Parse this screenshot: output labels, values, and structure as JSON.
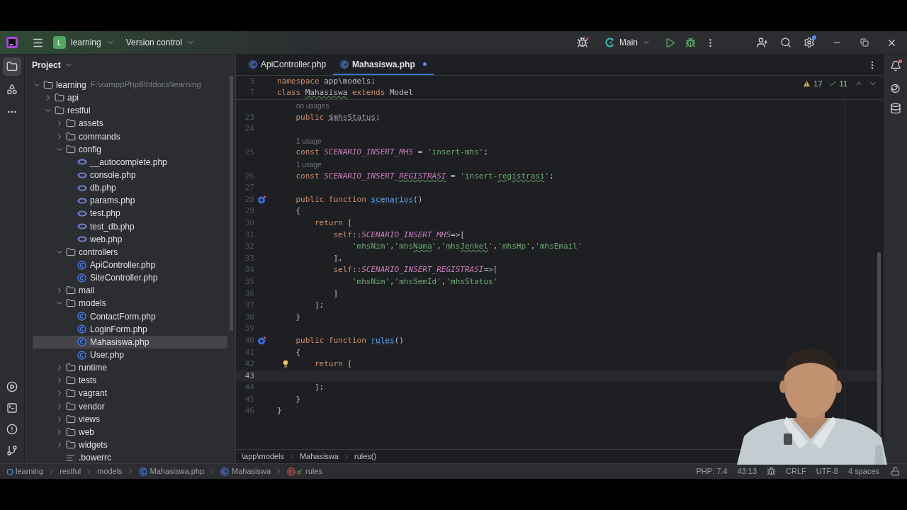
{
  "title_bar": {
    "project_badge": "L",
    "project": "learning",
    "vcs": "Version control",
    "run_config": "Main"
  },
  "left_toolbar": [
    {
      "kind": "project",
      "selected": true
    },
    {
      "kind": "structure",
      "selected": false
    },
    {
      "kind": "more",
      "selected": false
    }
  ],
  "project": {
    "title": "Project",
    "tree": [
      {
        "name": "learning",
        "kind": "folder",
        "expanded": true,
        "selected": false,
        "path": "F:\\xamppPhp8\\htdocs\\learning",
        "children": [
          {
            "name": "api",
            "kind": "folder",
            "expanded": false,
            "selected": false
          },
          {
            "name": "restful",
            "kind": "folder",
            "expanded": true,
            "selected": false,
            "children": [
              {
                "name": "assets",
                "kind": "folder",
                "expanded": false,
                "selected": false
              },
              {
                "name": "commands",
                "kind": "folder",
                "expanded": false,
                "selected": false
              },
              {
                "name": "config",
                "kind": "folder",
                "expanded": true,
                "selected": false,
                "children": [
                  {
                    "name": "__autocomplete.php",
                    "kind": "php",
                    "selected": false
                  },
                  {
                    "name": "console.php",
                    "kind": "php",
                    "selected": false
                  },
                  {
                    "name": "db.php",
                    "kind": "php",
                    "selected": false
                  },
                  {
                    "name": "params.php",
                    "kind": "php",
                    "selected": false
                  },
                  {
                    "name": "test.php",
                    "kind": "php",
                    "selected": false
                  },
                  {
                    "name": "test_db.php",
                    "kind": "php",
                    "selected": false
                  },
                  {
                    "name": "web.php",
                    "kind": "php",
                    "selected": false
                  }
                ]
              },
              {
                "name": "controllers",
                "kind": "folder",
                "expanded": true,
                "selected": false,
                "children": [
                  {
                    "name": "ApiController.php",
                    "kind": "class",
                    "selected": false
                  },
                  {
                    "name": "SiteController.php",
                    "kind": "class",
                    "selected": false
                  }
                ]
              },
              {
                "name": "mail",
                "kind": "folder",
                "expanded": false,
                "selected": false
              },
              {
                "name": "models",
                "kind": "folder",
                "expanded": true,
                "selected": false,
                "children": [
                  {
                    "name": "ContactForm.php",
                    "kind": "class",
                    "selected": false
                  },
                  {
                    "name": "LoginForm.php",
                    "kind": "class",
                    "selected": false
                  },
                  {
                    "name": "Mahasiswa.php",
                    "kind": "class",
                    "selected": true
                  },
                  {
                    "name": "User.php",
                    "kind": "class",
                    "selected": false
                  }
                ]
              },
              {
                "name": "runtime",
                "kind": "folder",
                "expanded": false,
                "selected": false
              },
              {
                "name": "tests",
                "kind": "folder",
                "expanded": false,
                "selected": false
              },
              {
                "name": "vagrant",
                "kind": "folder",
                "expanded": false,
                "selected": false
              },
              {
                "name": "vendor",
                "kind": "folder",
                "expanded": false,
                "selected": false
              },
              {
                "name": "views",
                "kind": "folder",
                "expanded": false,
                "selected": false
              },
              {
                "name": "web",
                "kind": "folder",
                "expanded": false,
                "selected": false
              },
              {
                "name": "widgets",
                "kind": "folder",
                "expanded": false,
                "selected": false
              },
              {
                "name": ".bowerrc",
                "kind": "text",
                "selected": false
              }
            ]
          }
        ]
      }
    ]
  },
  "tabs": [
    {
      "label": "ApiController.php",
      "selected": false,
      "modified": false
    },
    {
      "label": "Mahasiswa.php",
      "selected": true,
      "modified": true
    }
  ],
  "inspections": {
    "warnings": "17",
    "weak_warnings": "11"
  },
  "sticky_lines": [
    {
      "number": "3",
      "tokens": [
        {
          "kind": "kw",
          "text": "namespace"
        },
        {
          "kind": "text",
          "text": " app\\models;"
        }
      ]
    },
    {
      "number": "7",
      "tokens": [
        {
          "kind": "kw",
          "text": "class "
        },
        {
          "kind": "text",
          "text": "Mahasiswa",
          "typo": true
        },
        {
          "kind": "kw",
          "text": " extends"
        },
        {
          "kind": "text",
          "text": " Model"
        }
      ]
    }
  ],
  "lines": [
    {
      "kind": "hint",
      "text": "no usages"
    },
    {
      "kind": "code",
      "number": "23",
      "current": false,
      "tokens": [
        {
          "kind": "kw",
          "text": "    public "
        },
        {
          "kind": "var",
          "text": "$mhsStatus"
        },
        {
          "kind": "text",
          "text": ";"
        }
      ]
    },
    {
      "kind": "code",
      "number": "24",
      "current": false
    },
    {
      "kind": "hint",
      "text": "1 usage"
    },
    {
      "kind": "code",
      "number": "25",
      "current": false,
      "tokens": [
        {
          "kind": "kw",
          "text": "    const "
        },
        {
          "kind": "const",
          "text": "SCENARIO_INSERT_MHS"
        },
        {
          "kind": "text",
          "text": " = "
        },
        {
          "kind": "str",
          "text": "'insert-mhs'"
        },
        {
          "kind": "text",
          "text": ";"
        }
      ]
    },
    {
      "kind": "hint",
      "text": "1 usage"
    },
    {
      "kind": "code",
      "number": "26",
      "current": false,
      "tokens": [
        {
          "kind": "kw",
          "text": "    const "
        },
        {
          "kind": "const",
          "text": "SCENARIO_INSERT_"
        },
        {
          "kind": "const",
          "text": "REGISTRASI",
          "typo": true
        },
        {
          "kind": "text",
          "text": " = "
        },
        {
          "kind": "str",
          "text": "'insert-"
        },
        {
          "kind": "str",
          "text": "registrasi",
          "typo": true
        },
        {
          "kind": "str",
          "text": "'"
        },
        {
          "kind": "text",
          "text": ";"
        }
      ]
    },
    {
      "kind": "code",
      "number": "27",
      "current": false
    },
    {
      "kind": "override",
      "number": "28",
      "current": false,
      "tokens": [
        {
          "kind": "kw",
          "text": "    public function "
        },
        {
          "kind": "fn",
          "text": "scenarios"
        },
        {
          "kind": "text",
          "text": "()"
        }
      ]
    },
    {
      "kind": "code",
      "number": "29",
      "current": false,
      "tokens": [
        {
          "kind": "text",
          "text": "    {"
        }
      ]
    },
    {
      "kind": "code",
      "number": "30",
      "current": false,
      "tokens": [
        {
          "kind": "kw",
          "text": "        return"
        },
        {
          "kind": "text",
          "text": " ["
        }
      ]
    },
    {
      "kind": "code",
      "number": "31",
      "current": false,
      "tokens": [
        {
          "kind": "kw",
          "text": "            self"
        },
        {
          "kind": "text",
          "text": "::"
        },
        {
          "kind": "const",
          "text": "SCENARIO_INSERT_MHS"
        },
        {
          "kind": "text",
          "text": "=>["
        }
      ]
    },
    {
      "kind": "code",
      "number": "32",
      "current": false,
      "tokens": [
        {
          "kind": "str",
          "text": "                'mhsNim'"
        },
        {
          "kind": "text",
          "text": ","
        },
        {
          "kind": "str",
          "text": "'mhs"
        },
        {
          "kind": "str",
          "text": "Nama",
          "typo": true
        },
        {
          "kind": "str",
          "text": "'"
        },
        {
          "kind": "text",
          "text": ","
        },
        {
          "kind": "str",
          "text": "'mhs"
        },
        {
          "kind": "str",
          "text": "Jenkel",
          "typo": true
        },
        {
          "kind": "str",
          "text": "'"
        },
        {
          "kind": "text",
          "text": ","
        },
        {
          "kind": "str",
          "text": "'mhsHp'"
        },
        {
          "kind": "text",
          "text": ","
        },
        {
          "kind": "str",
          "text": "'mhsEmail'"
        }
      ]
    },
    {
      "kind": "code",
      "number": "33",
      "current": false,
      "tokens": [
        {
          "kind": "text",
          "text": "            ],"
        }
      ]
    },
    {
      "kind": "code",
      "number": "34",
      "current": false,
      "tokens": [
        {
          "kind": "kw",
          "text": "            self"
        },
        {
          "kind": "text",
          "text": "::"
        },
        {
          "kind": "const",
          "text": "SCENARIO_INSERT_REGISTRASI"
        },
        {
          "kind": "text",
          "text": "=>["
        }
      ]
    },
    {
      "kind": "code",
      "number": "35",
      "current": false,
      "tokens": [
        {
          "kind": "str",
          "text": "                'mhsNim'"
        },
        {
          "kind": "text",
          "text": ","
        },
        {
          "kind": "str",
          "text": "'mhsSemId'"
        },
        {
          "kind": "text",
          "text": ","
        },
        {
          "kind": "str",
          "text": "'mhsStatus'"
        }
      ]
    },
    {
      "kind": "code",
      "number": "36",
      "current": false,
      "tokens": [
        {
          "kind": "text",
          "text": "            ]"
        }
      ]
    },
    {
      "kind": "code",
      "number": "37",
      "current": false,
      "tokens": [
        {
          "kind": "text",
          "text": "        ];"
        }
      ]
    },
    {
      "kind": "code",
      "number": "38",
      "current": false,
      "tokens": [
        {
          "kind": "text",
          "text": "    }"
        }
      ]
    },
    {
      "kind": "code",
      "number": "39",
      "current": false
    },
    {
      "kind": "override",
      "number": "40",
      "current": false,
      "tokens": [
        {
          "kind": "kw",
          "text": "    public function "
        },
        {
          "kind": "fn",
          "text": "rules"
        },
        {
          "kind": "text",
          "text": "()"
        }
      ]
    },
    {
      "kind": "code",
      "number": "41",
      "current": false,
      "tokens": [
        {
          "kind": "text",
          "text": "    {"
        }
      ]
    },
    {
      "kind": "bulb",
      "number": "42",
      "current": false,
      "tokens": [
        {
          "kind": "kw",
          "text": "        return"
        },
        {
          "kind": "text",
          "text": " ["
        }
      ]
    },
    {
      "kind": "code",
      "number": "43",
      "current": true
    },
    {
      "kind": "code",
      "number": "44",
      "current": false,
      "tokens": [
        {
          "kind": "text",
          "text": "        ];"
        }
      ]
    },
    {
      "kind": "code",
      "number": "45",
      "current": false,
      "tokens": [
        {
          "kind": "text",
          "text": "    }"
        }
      ]
    },
    {
      "kind": "code",
      "number": "46",
      "current": false,
      "tokens": [
        {
          "kind": "text",
          "text": "}"
        }
      ]
    }
  ],
  "editor_breadcrumbs": [
    "\\app\\models",
    "Mahasiswa",
    "rules()"
  ],
  "webcam": {
    "kind": "picture"
  },
  "status_bar": {
    "breadcrumbs": [
      {
        "kind": "module",
        "text": "learning"
      },
      {
        "kind": "dir",
        "text": "restful"
      },
      {
        "kind": "dir",
        "text": "models"
      },
      {
        "kind": "class",
        "text": "Mahasiswa.php"
      },
      {
        "kind": "class",
        "text": "Mahasiswa"
      },
      {
        "kind": "method",
        "text": "rules"
      }
    ],
    "position": [
      "PHP: 7.4",
      "43:13"
    ],
    "file_info": [
      "CRLF",
      "UTF-8",
      "4 spaces"
    ]
  }
}
